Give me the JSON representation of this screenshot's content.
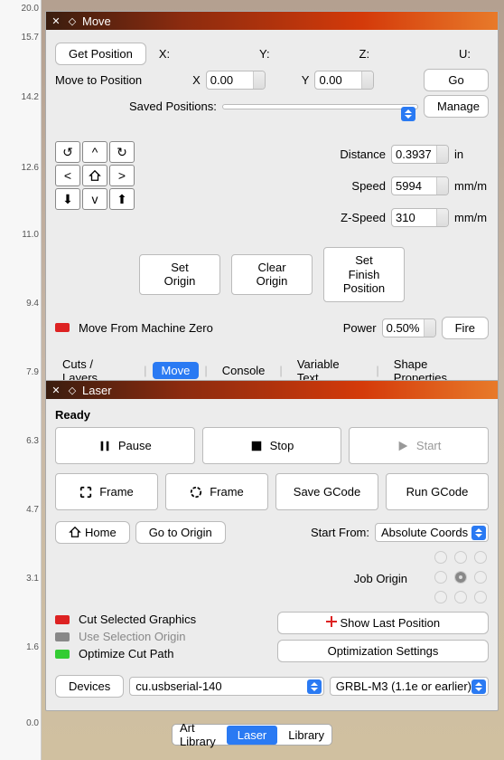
{
  "ruler": [
    "20.0",
    "15.7",
    "14.2",
    "12.6",
    "11.0",
    "9.4",
    "7.9",
    "6.3",
    "4.7",
    "3.1",
    "1.6",
    "0.0"
  ],
  "move": {
    "title": "Move",
    "get_position": "Get Position",
    "axis_x": "X:",
    "axis_y": "Y:",
    "axis_z": "Z:",
    "axis_u": "U:",
    "move_to_position": "Move to Position",
    "x_lbl": "X",
    "y_lbl": "Y",
    "x_val": "0.00",
    "y_val": "0.00",
    "go": "Go",
    "saved_positions": "Saved Positions:",
    "manage": "Manage",
    "distance_lbl": "Distance",
    "distance_val": "0.3937",
    "distance_unit": "in",
    "speed_lbl": "Speed",
    "speed_val": "5994",
    "speed_unit": "mm/m",
    "zspeed_lbl": "Z-Speed",
    "zspeed_val": "310",
    "zspeed_unit": "mm/m",
    "set_origin": "Set\nOrigin",
    "clear_origin": "Clear\nOrigin",
    "set_finish": "Set Finish\nPosition",
    "move_from_zero": "Move From Machine Zero",
    "power_lbl": "Power",
    "power_val": "0.50%",
    "fire": "Fire",
    "tabs": [
      "Cuts / Layers",
      "Move",
      "Console",
      "Variable Text",
      "Shape Properties"
    ],
    "active_tab": "Move"
  },
  "laser": {
    "title": "Laser",
    "status": "Ready",
    "pause": "Pause",
    "stop": "Stop",
    "start": "Start",
    "frame": "Frame",
    "save_gcode": "Save GCode",
    "run_gcode": "Run GCode",
    "home": "Home",
    "go_origin": "Go to Origin",
    "start_from": "Start From:",
    "start_from_value": "Absolute Coords",
    "job_origin": "Job Origin",
    "cut_selected": "Cut Selected Graphics",
    "use_selection_origin": "Use Selection Origin",
    "optimize_cut_path": "Optimize Cut Path",
    "show_last": "Show Last Position",
    "optimization_settings": "Optimization Settings",
    "devices": "Devices",
    "port": "cu.usbserial-140",
    "controller": "GRBL-M3 (1.1e or earlier)"
  },
  "bottom_tabs": [
    "Art Library",
    "Laser",
    "Library"
  ],
  "bottom_active": "Laser"
}
